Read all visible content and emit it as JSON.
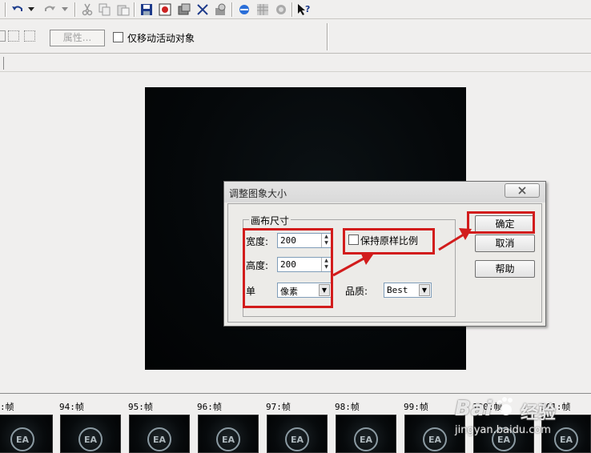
{
  "toolbar": {
    "icons": [
      "undo-icon",
      "dropdown-icon",
      "redo-icon",
      "dropdown-icon",
      "cut-icon",
      "copy-icon",
      "paste-icon",
      "save-icon",
      "export-icon",
      "image-icon",
      "crop-icon",
      "rotate-icon",
      "browser-icon",
      "grid-icon",
      "web-icon",
      "help-pointer-icon"
    ]
  },
  "propbar": {
    "attr_button": "属性...",
    "move_only_label": "仅移动活动对象"
  },
  "dialog": {
    "title": "调整图象大小",
    "group_title": "画布尺寸",
    "width_label": "宽度:",
    "width_value": "200",
    "height_label": "高度:",
    "height_value": "200",
    "unit_label": "单",
    "unit_value": "像素",
    "keep_ratio_label": "保持原样比例",
    "quality_label": "品质:",
    "quality_value": "Best",
    "ok_label": "确定",
    "cancel_label": "取消",
    "help_label": "帮助"
  },
  "timeline": {
    "frames": [
      "94:帧",
      "95:帧",
      "96:帧",
      "97:帧",
      "98:帧",
      "99:帧",
      "100:帧",
      "101:帧"
    ],
    "first_partial": ":帧",
    "logo_text": "EA"
  },
  "watermark": {
    "text": "Bai",
    "brand": "经验",
    "url": "jingyan.baidu.com"
  },
  "colors": {
    "annotation_red": "#d21c1c",
    "canvas": "#05080a"
  }
}
